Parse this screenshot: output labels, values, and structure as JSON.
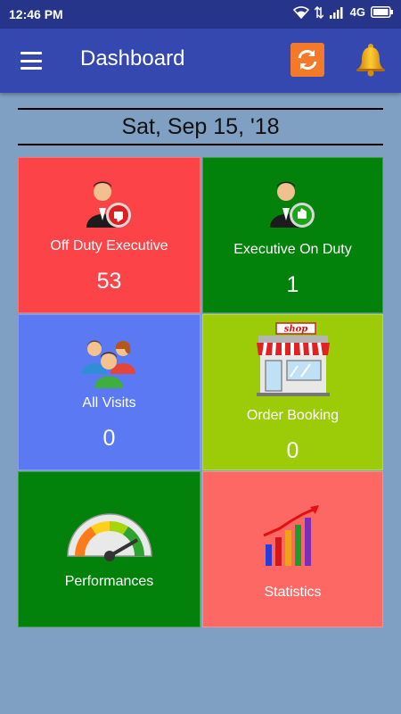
{
  "status_bar": {
    "time": "12:46 PM",
    "network": "4G"
  },
  "app_bar": {
    "title": "Dashboard"
  },
  "date": "Sat, Sep 15, '18",
  "tiles": [
    {
      "label": "Off Duty Executive",
      "value": "53",
      "color": "#fc4347",
      "icon": "executive-off-duty-icon"
    },
    {
      "label": "Executive On Duty",
      "value": "1",
      "color": "#03820b",
      "icon": "executive-on-duty-icon"
    },
    {
      "label": "All Visits",
      "value": "0",
      "color": "#5a79f3",
      "icon": "people-group-icon"
    },
    {
      "label": "Order Booking",
      "value": "0",
      "color": "#9ccc08",
      "icon": "shop-icon",
      "icon_text": "shop"
    },
    {
      "label": "Performances",
      "color": "#03820b",
      "icon": "speedometer-icon"
    },
    {
      "label": "Statistics",
      "color": "#fd6864",
      "icon": "bar-chart-icon"
    }
  ],
  "colors": {
    "status_bar": "#26348a",
    "app_bar": "#3548b0",
    "background": "#7f9fc3",
    "sync_button": "#f47a2a"
  }
}
